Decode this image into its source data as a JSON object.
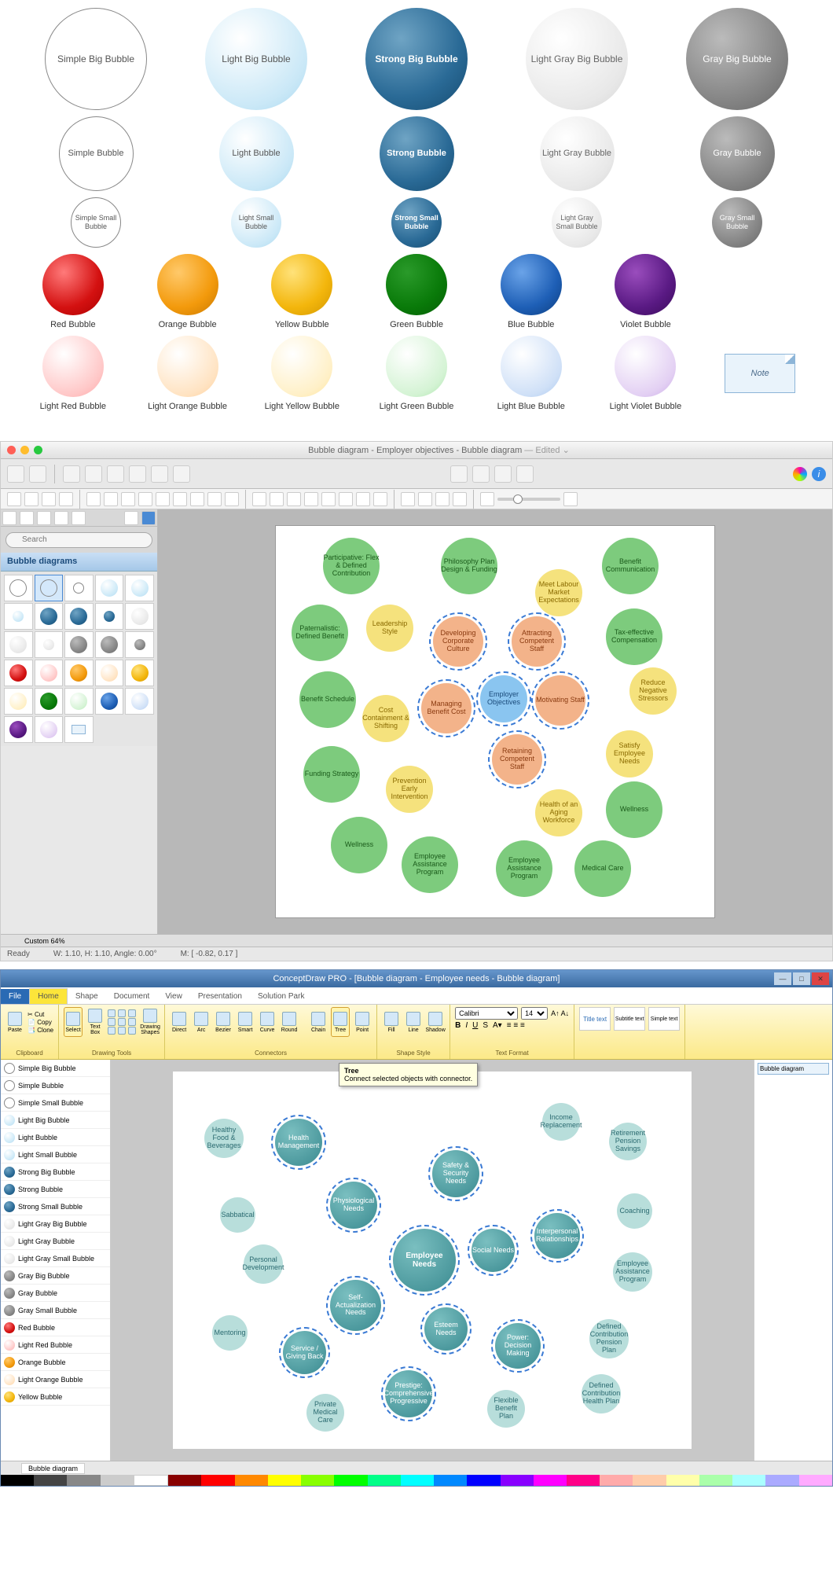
{
  "palette": {
    "row1": [
      "Simple Big Bubble",
      "Light Big Bubble",
      "Strong Big Bubble",
      "Light Gray Big Bubble",
      "Gray Big Bubble"
    ],
    "row2": [
      "Simple Bubble",
      "Light Bubble",
      "Strong Bubble",
      "Light Gray Bubble",
      "Gray Bubble"
    ],
    "row3": [
      "Simple Small Bubble",
      "Light Small Bubble",
      "Strong Small Bubble",
      "Light Gray Small Bubble",
      "Gray Small Bubble"
    ],
    "colors": [
      "Red Bubble",
      "Orange Bubble",
      "Yellow Bubble",
      "Green Bubble",
      "Blue Bubble",
      "Violet Bubble"
    ],
    "lights": [
      "Light Red Bubble",
      "Light Orange Bubble",
      "Light Yellow Bubble",
      "Light Green Bubble",
      "Light Blue Bubble",
      "Light Violet Bubble"
    ],
    "note": "Note"
  },
  "mac": {
    "title": "Bubble diagram - Employer objectives - Bubble diagram",
    "edited": "— Edited",
    "search_placeholder": "Search",
    "panel_title": "Bubble diagrams",
    "zoom_label": "Custom 64%",
    "status_ready": "Ready",
    "status_wh": "W: 1.10,  H: 1.10,  Angle: 0.00°",
    "status_m": "M: [ -0.82, 0.17 ]",
    "bubbles": {
      "participative": "Participative: Flex & Defined Contribution",
      "philosophy": "Philosophy Plan Design & Funding",
      "benefit_comm": "Benefit Communication",
      "meet_labour": "Meet Labour Market Expectations",
      "paternalistic": "Paternalistic: Defined Benefit",
      "leadership": "Leadership Style",
      "developing": "Developing Corporate Culture",
      "attracting": "Attracting Competent Staff",
      "tax": "Tax-effective Compensation",
      "benefit_sched": "Benefit Schedule",
      "employer_obj": "Employer Objectives",
      "motivating": "Motivating Staff",
      "reduce_neg": "Reduce Negative Stressors",
      "cost_cont": "Cost Containment & Shifting",
      "managing": "Managing Benefit Cost",
      "retaining": "Retaining Competent Staff",
      "satisfy": "Satisfy Employee Needs",
      "funding": "Funding Strategy",
      "prevention": "Prevention Early Intervention",
      "health_aging": "Health of an Aging Workforce",
      "wellness1": "Wellness",
      "wellness2": "Wellness",
      "eap1": "Employee Assistance Program",
      "eap2": "Employee Assistance Program",
      "medical": "Medical Care"
    }
  },
  "win": {
    "title": "ConceptDraw PRO - [Bubble diagram - Employee needs - Bubble diagram]",
    "tabs": [
      "File",
      "Home",
      "Shape",
      "Document",
      "View",
      "Presentation",
      "Solution Park"
    ],
    "ribbon": {
      "clipboard": "Clipboard",
      "paste": "Paste",
      "cut": "Cut",
      "copy": "Copy",
      "clone": "Clone",
      "select": "Select",
      "textbox": "Text Box",
      "drawing_tools": "Drawing Tools",
      "drawing_shapes": "Drawing Shapes",
      "direct": "Direct",
      "arc": "Arc",
      "bezier": "Bezier",
      "smart": "Smart",
      "curve": "Curve",
      "round": "Round",
      "connectors": "Connectors",
      "chain": "Chain",
      "tree": "Tree",
      "point": "Point",
      "fill": "Fill",
      "line": "Line",
      "shadow": "Shadow",
      "shape_style": "Shape Style",
      "font": "Calibri",
      "size": "14",
      "text_format": "Text Format",
      "title_text": "Title text",
      "subtitle": "Subtitle text",
      "simple": "Simple text"
    },
    "tooltip_title": "Tree",
    "tooltip_body": "Connect selected objects with connector.",
    "side_items": [
      "Simple Big Bubble",
      "Simple Bubble",
      "Simple Small Bubble",
      "Light Big Bubble",
      "Light Bubble",
      "Light Small Bubble",
      "Strong Big Bubble",
      "Strong Bubble",
      "Strong Small Bubble",
      "Light Gray Big Bubble",
      "Light Gray Bubble",
      "Light Gray Small Bubble",
      "Gray Big Bubble",
      "Gray Bubble",
      "Gray Small Bubble",
      "Red Bubble",
      "Light Red Bubble",
      "Orange Bubble",
      "Light Orange Bubble",
      "Yellow Bubble"
    ],
    "right_panel": "Bubble diagram",
    "doc_tab": "Bubble diagram",
    "bubbles": {
      "employee_needs": "Employee Needs",
      "health_mgmt": "Health Management",
      "phys": "Physiological Needs",
      "safety": "Safety & Security Needs",
      "social": "Social Needs",
      "self_act": "Self-Actualization Needs",
      "esteem": "Esteem Needs",
      "service": "Service / Giving Back",
      "prestige": "Prestige: Comprehensive Progressive",
      "power": "Power: Decision Making",
      "interpersonal": "Interpersonal Relationships",
      "healthy_food": "Healthy Food & Beverages",
      "sabbatical": "Sabbatical",
      "personal_dev": "Personal Development",
      "mentoring": "Mentoring",
      "private_med": "Private Medical Care",
      "income": "Income Replacement",
      "retirement": "Retirement Pension Savings",
      "coaching": "Coaching",
      "eap": "Employee Assistance Program",
      "dc_pension": "Defined Contribution Pension Plan",
      "dc_health": "Defined Contribution Health Plan",
      "flexible": "Flexible Benefit Plan"
    }
  }
}
